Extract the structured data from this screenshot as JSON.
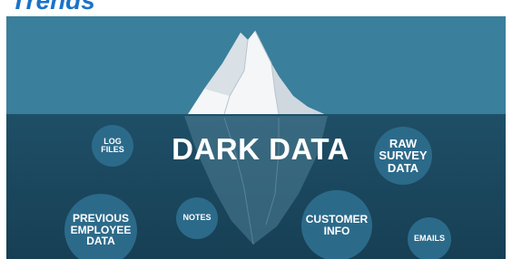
{
  "heading": "Trends",
  "diagram": {
    "title": "DARK DATA",
    "bubbles": {
      "log_files": "LOG\nFILES",
      "raw_survey_data": "RAW\nSURVEY\nDATA",
      "previous_employee_data": "PREVIOUS\nEMPLOYEE\nDATA",
      "notes": "NOTES",
      "customer_info": "CUSTOMER\nINFO",
      "emails": "EMAILS"
    }
  },
  "colors": {
    "heading": "#1a73c9",
    "sky": "#3a7f9b",
    "water": "#1e4f67",
    "bubble": "#2c6a8a",
    "ice": "#ffffff"
  }
}
